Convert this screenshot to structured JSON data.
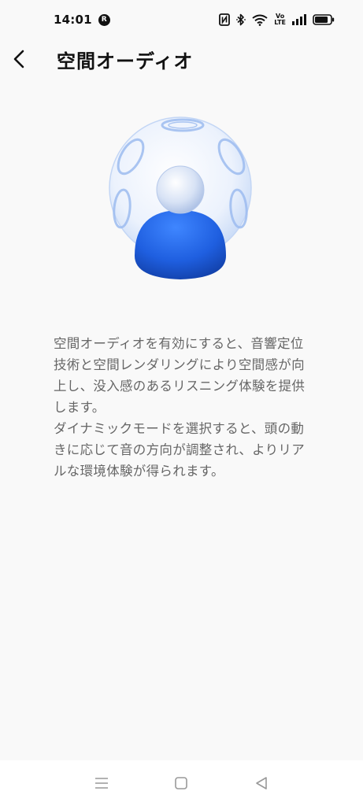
{
  "status_bar": {
    "time": "14:01",
    "notification_badge": "R",
    "volte_label_top": "Vo",
    "volte_label_bottom": "LTE",
    "icons": [
      "nfc-icon",
      "bluetooth-icon",
      "wifi-icon",
      "volte-icon",
      "signal-icon",
      "battery-icon"
    ],
    "battery_level": 0.85
  },
  "app_bar": {
    "back_icon": "chevron-left-icon",
    "title": "空間オーディオ"
  },
  "description": {
    "paragraph_1": "空間オーディオを有効にすると、音響定位技術と空間レンダリングにより空間感が向上し、没入感のあるリスニング体験を提供します。",
    "paragraph_2": "ダイナミックモードを選択すると、頭の動きに応じて音の方向が調整され、よりリアルな環境体験が得られます。"
  },
  "nav_bar": {
    "icons": [
      "menu-icon",
      "home-icon",
      "back-triangle-icon"
    ]
  },
  "colors": {
    "background": "#f9f9f9",
    "accent_blue": "#2a6be8",
    "text_secondary": "#666666"
  }
}
